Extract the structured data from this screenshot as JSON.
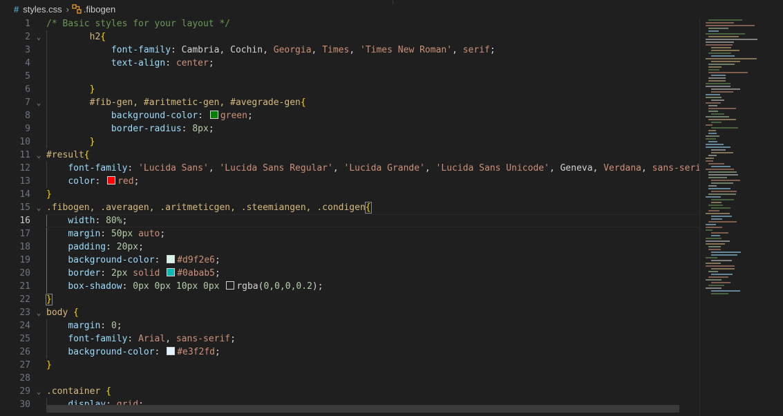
{
  "breadcrumb": {
    "file_icon": "css-hash-icon",
    "file": "styles.css",
    "separator": ">",
    "symbol_icon": "css-selector-icon",
    "symbol": ".fibogen"
  },
  "active_line": 16,
  "line_numbers": [
    "1",
    "2",
    "3",
    "4",
    "5",
    "6",
    "7",
    "8",
    "9",
    "10",
    "11",
    "12",
    "13",
    "14",
    "15",
    "16",
    "17",
    "18",
    "19",
    "20",
    "21",
    "22",
    "23",
    "24",
    "25",
    "26",
    "27",
    "28",
    "29",
    "30"
  ],
  "fold_markers": [
    "",
    "⌄",
    "",
    "",
    "",
    "",
    "⌄",
    "",
    "",
    "",
    "⌄",
    "",
    "",
    "",
    "⌄",
    "",
    "",
    "",
    "",
    "",
    "",
    "",
    "⌄",
    "",
    "",
    "",
    "",
    "",
    "⌄",
    ""
  ],
  "colors": {
    "green_swatch": "#008000",
    "red_swatch": "#ff0000",
    "d9f2e6_swatch": "#d9f2e6",
    "aabab5_swatch": "#0abab5",
    "rgba_swatch": "#1f1f1f",
    "e3f2fd_swatch": "#e3f2fd"
  },
  "code": {
    "l1": "/* Basic styles for your layout */",
    "l2_sel": "h2",
    "l2_brace": "{",
    "l3_prop": "font-family",
    "l3_v1": "Cambria",
    "l3_v2": "Cochin",
    "l3_v3": "Georgia",
    "l3_v4": "Times",
    "l3_v5": "'Times New Roman'",
    "l3_v6": "serif",
    "l4_prop": "text-align",
    "l4_val": "center",
    "l6_brace": "}",
    "l7_sel": "#fib-gen, #aritmetic-gen, #avegrade-gen",
    "l7_brace": "{",
    "l8_prop": "background-color",
    "l8_val": "green",
    "l9_prop": "border-radius",
    "l9_val": "8px",
    "l10_brace": "}",
    "l11_sel": "#result",
    "l11_brace": "{",
    "l12_prop": "font-family",
    "l12_v1": "'Lucida Sans'",
    "l12_v2": "'Lucida Sans Regular'",
    "l12_v3": "'Lucida Grande'",
    "l12_v4": "'Lucida Sans Unicode'",
    "l12_v5": "Geneva",
    "l12_v6": "Verdana",
    "l12_v7": "sans-serif",
    "l13_prop": "color",
    "l13_val": "red",
    "l14_brace": "}",
    "l15_sel": ".fibogen, .averagen, .aritmeticgen, .steemiangen, .condigen",
    "l15_brace": "{",
    "l16_prop": "width",
    "l16_val": "80%",
    "l17_prop": "margin",
    "l17_v1": "50px",
    "l17_v2": "auto",
    "l18_prop": "padding",
    "l18_val": "20px",
    "l19_prop": "background-color",
    "l19_val": "#d9f2e6",
    "l20_prop": "border",
    "l20_v1": "2px",
    "l20_v2": "solid",
    "l20_v3": "#0abab5",
    "l21_prop": "box-shadow",
    "l21_v1": "0px 0px 10px 0px",
    "l21_fn": "rgba",
    "l21_args": "0,0,0,0.2",
    "l22_brace": "}",
    "l23_sel": "body",
    "l23_brace": "{",
    "l24_prop": "margin",
    "l24_val": "0",
    "l25_prop": "font-family",
    "l25_v1": "Arial",
    "l25_v2": "sans-serif",
    "l26_prop": "background-color",
    "l26_val": "#e3f2fd",
    "l27_brace": "}",
    "l29_sel": ".container",
    "l29_brace": "{",
    "l30_prop": "display",
    "l30_val": "grid"
  }
}
